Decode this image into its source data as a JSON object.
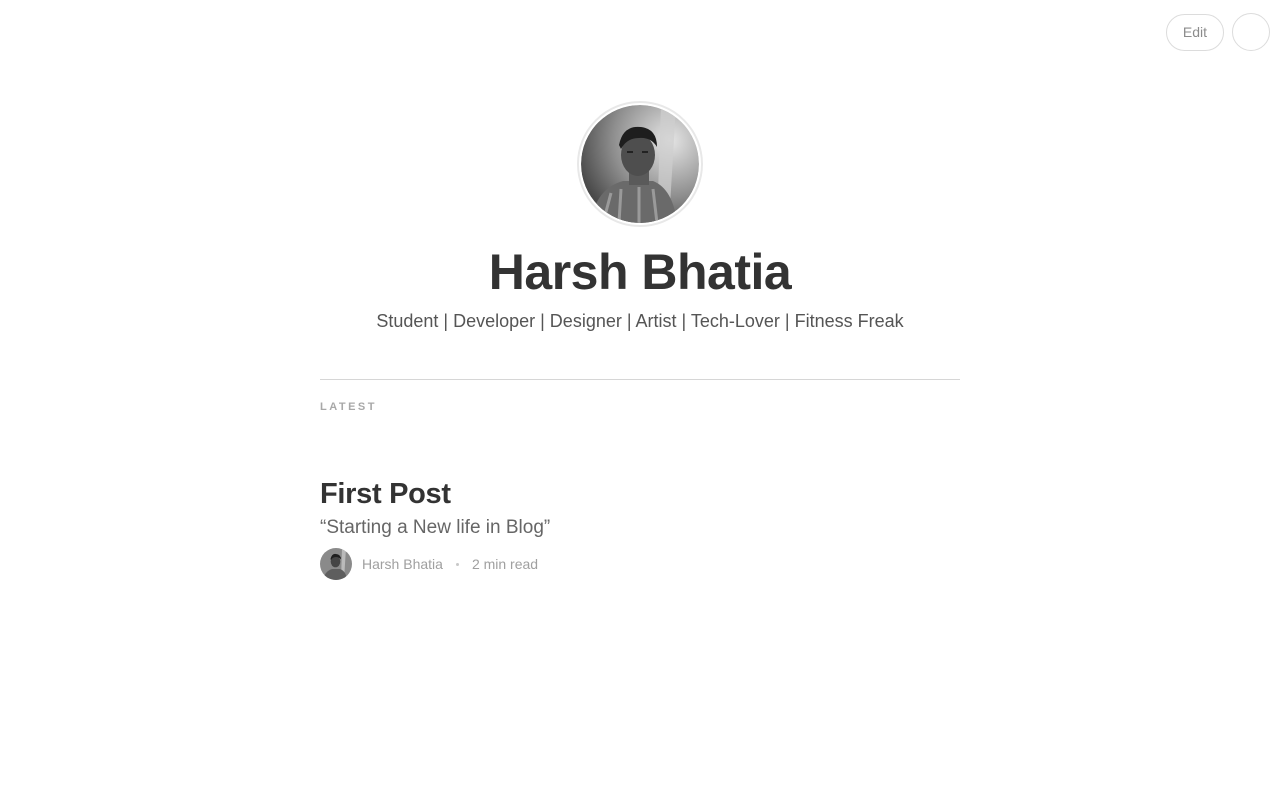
{
  "toolbar": {
    "edit_label": "Edit"
  },
  "profile": {
    "name": "Harsh Bhatia",
    "bio": "Student | Developer | Designer | Artist | Tech-Lover | Fitness Freak"
  },
  "section": {
    "label": "LATEST"
  },
  "posts": [
    {
      "title": "First Post",
      "subtitle": "“Starting a New life in Blog”",
      "author": "Harsh Bhatia",
      "read_time": "2 min read"
    }
  ],
  "icons": {
    "profile_avatar": "user-photo-icon",
    "author_avatar": "user-photo-icon",
    "user_menu": "user-avatar-icon"
  }
}
